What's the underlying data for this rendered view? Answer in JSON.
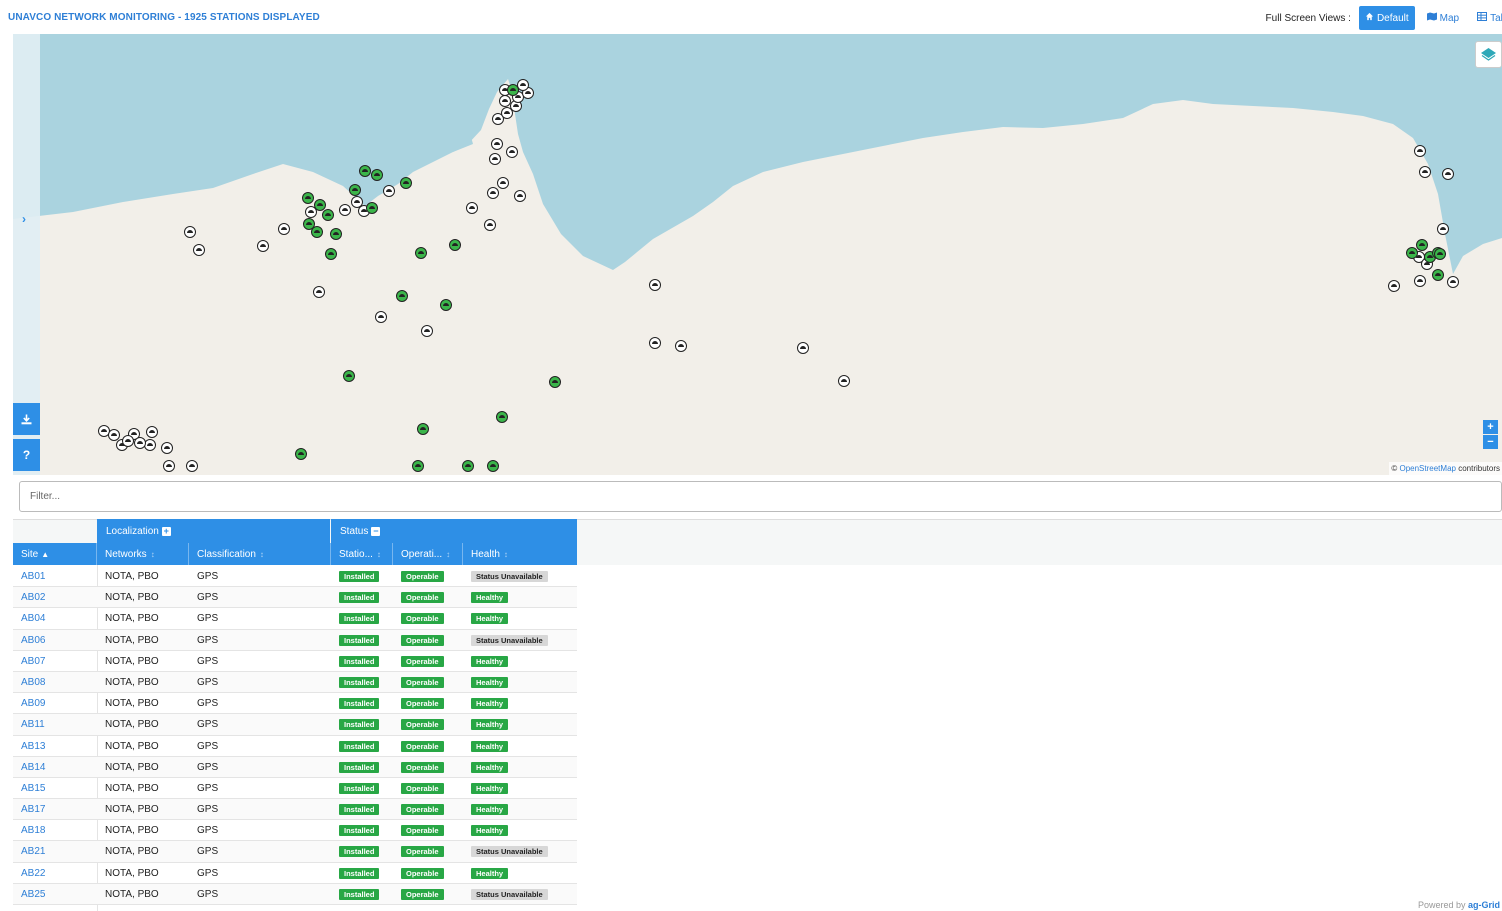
{
  "header": {
    "title": "UNAVCO NETWORK MONITORING - 1925 STATIONS DISPLAYED",
    "views_label": "Full Screen Views :",
    "views": [
      {
        "label": "Default",
        "icon": "home-icon",
        "active": true
      },
      {
        "label": "Map",
        "icon": "map-icon",
        "active": false
      },
      {
        "label": "Table",
        "icon": "table-icon",
        "active": false
      }
    ]
  },
  "map": {
    "attribution_prefix": "©",
    "attribution_link": "OpenStreetMap",
    "attribution_suffix": "contributors",
    "zoom_in": "+",
    "zoom_out": "−",
    "download_icon": "download-icon",
    "help_label": "?",
    "expand_icon": "chevron-right-icon",
    "layers_icon": "layers-icon",
    "colors": {
      "water": "#aad3df",
      "land": "#f2efe9",
      "operational": "#3bb54a",
      "other": "#ffffff"
    }
  },
  "filter": {
    "placeholder": "Filter..."
  },
  "grid": {
    "groups": {
      "localization": "Localization",
      "status": "Status"
    },
    "columns": {
      "site": "Site",
      "networks": "Networks",
      "classification": "Classification",
      "station": "Statio...",
      "operational": "Operati...",
      "health": "Health"
    },
    "rows": [
      {
        "site": "AB01",
        "networks": "NOTA, PBO",
        "classification": "GPS",
        "station": "Installed",
        "operational": "Operable",
        "health": "Status Unavailable"
      },
      {
        "site": "AB02",
        "networks": "NOTA, PBO",
        "classification": "GPS",
        "station": "Installed",
        "operational": "Operable",
        "health": "Healthy"
      },
      {
        "site": "AB04",
        "networks": "NOTA, PBO",
        "classification": "GPS",
        "station": "Installed",
        "operational": "Operable",
        "health": "Healthy"
      },
      {
        "site": "AB06",
        "networks": "NOTA, PBO",
        "classification": "GPS",
        "station": "Installed",
        "operational": "Operable",
        "health": "Status Unavailable"
      },
      {
        "site": "AB07",
        "networks": "NOTA, PBO",
        "classification": "GPS",
        "station": "Installed",
        "operational": "Operable",
        "health": "Healthy"
      },
      {
        "site": "AB08",
        "networks": "NOTA, PBO",
        "classification": "GPS",
        "station": "Installed",
        "operational": "Operable",
        "health": "Healthy"
      },
      {
        "site": "AB09",
        "networks": "NOTA, PBO",
        "classification": "GPS",
        "station": "Installed",
        "operational": "Operable",
        "health": "Healthy"
      },
      {
        "site": "AB11",
        "networks": "NOTA, PBO",
        "classification": "GPS",
        "station": "Installed",
        "operational": "Operable",
        "health": "Healthy"
      },
      {
        "site": "AB13",
        "networks": "NOTA, PBO",
        "classification": "GPS",
        "station": "Installed",
        "operational": "Operable",
        "health": "Healthy"
      },
      {
        "site": "AB14",
        "networks": "NOTA, PBO",
        "classification": "GPS",
        "station": "Installed",
        "operational": "Operable",
        "health": "Healthy"
      },
      {
        "site": "AB15",
        "networks": "NOTA, PBO",
        "classification": "GPS",
        "station": "Installed",
        "operational": "Operable",
        "health": "Healthy"
      },
      {
        "site": "AB17",
        "networks": "NOTA, PBO",
        "classification": "GPS",
        "station": "Installed",
        "operational": "Operable",
        "health": "Healthy"
      },
      {
        "site": "AB18",
        "networks": "NOTA, PBO",
        "classification": "GPS",
        "station": "Installed",
        "operational": "Operable",
        "health": "Healthy"
      },
      {
        "site": "AB21",
        "networks": "NOTA, PBO",
        "classification": "GPS",
        "station": "Installed",
        "operational": "Operable",
        "health": "Status Unavailable"
      },
      {
        "site": "AB22",
        "networks": "NOTA, PBO",
        "classification": "GPS",
        "station": "Installed",
        "operational": "Operable",
        "health": "Healthy"
      },
      {
        "site": "AB25",
        "networks": "NOTA, PBO",
        "classification": "GPS",
        "station": "Installed",
        "operational": "Operable",
        "health": "Status Unavailable"
      }
    ]
  },
  "footer": {
    "powered_by": "Powered by",
    "brand": "ag-Grid"
  }
}
